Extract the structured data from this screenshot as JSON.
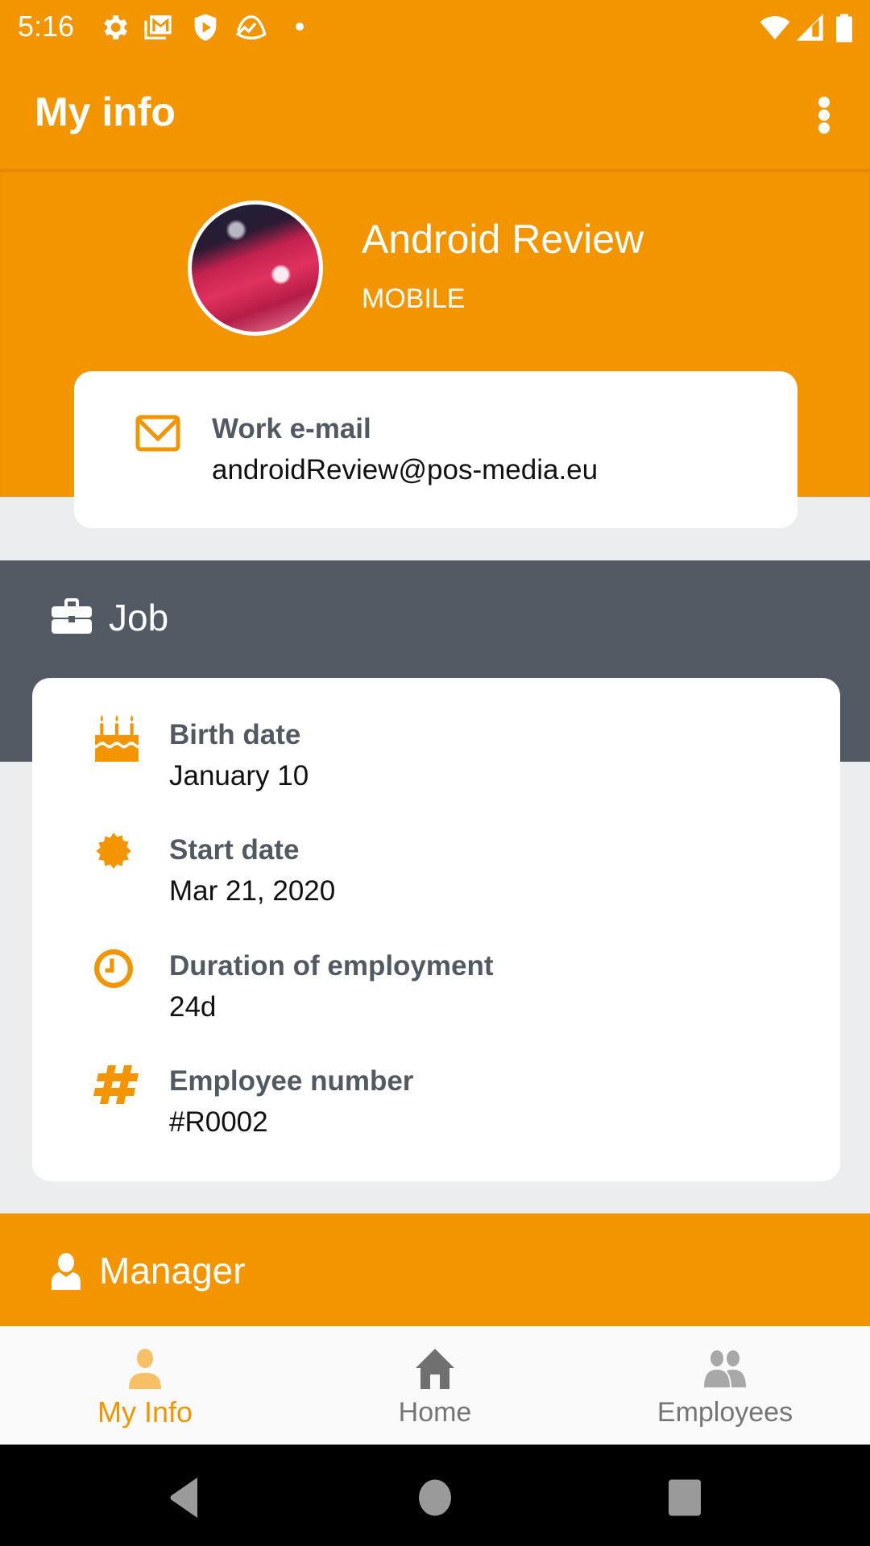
{
  "status_bar": {
    "time": "5:16",
    "left_icons": [
      "gear-icon",
      "gmail-icon",
      "shield-play-icon",
      "basecamp-icon",
      "notification-dot-icon"
    ],
    "right_icons": [
      "wifi-icon",
      "cellular-signal-icon",
      "battery-icon"
    ]
  },
  "app_bar": {
    "title": "My info",
    "menu_icon": "more-vert-icon"
  },
  "profile": {
    "name": "Android Review",
    "department": "MOBILE",
    "email_label": "Work e-mail",
    "email_value": "androidReview@pos-media.eu"
  },
  "job": {
    "title": "Job",
    "rows": [
      {
        "icon": "birthday-cake-icon",
        "label": "Birth date",
        "value": "January 10"
      },
      {
        "icon": "badge-starburst-icon",
        "label": "Start date",
        "value": "Mar 21, 2020"
      },
      {
        "icon": "clock-icon",
        "label": "Duration of employment",
        "value": "24d"
      },
      {
        "icon": "hashtag-icon",
        "label": "Employee number",
        "value": "#R0002"
      }
    ]
  },
  "manager": {
    "title": "Manager"
  },
  "bottom_nav": {
    "items": [
      {
        "label": "My Info",
        "icon": "person-icon",
        "active": true
      },
      {
        "label": "Home",
        "icon": "home-icon",
        "active": false
      },
      {
        "label": "Employees",
        "icon": "people-icon",
        "active": false
      }
    ]
  },
  "colors": {
    "primary": "#f29500",
    "section_dark": "#525b63",
    "background": "#ebedef",
    "label_text": "#515a62",
    "nav_inactive": "#757575"
  }
}
